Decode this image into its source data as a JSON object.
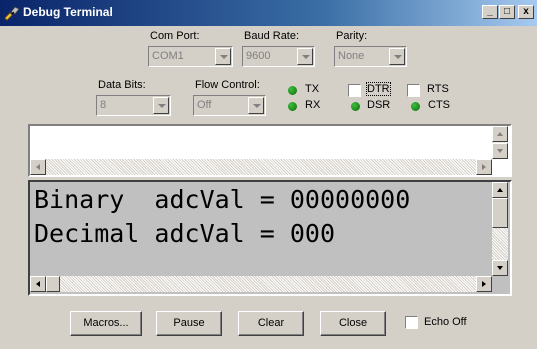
{
  "window": {
    "title": "Debug Terminal",
    "controls": {
      "minimize": "_",
      "maximize": "□",
      "close": "x"
    }
  },
  "settings": {
    "com_port": {
      "label": "Com Port:",
      "value": "COM1"
    },
    "baud_rate": {
      "label": "Baud Rate:",
      "value": "9600"
    },
    "parity": {
      "label": "Parity:",
      "value": "None"
    },
    "data_bits": {
      "label": "Data Bits:",
      "value": "8"
    },
    "flow_control": {
      "label": "Flow Control:",
      "value": "Off"
    }
  },
  "signals": {
    "tx": "TX",
    "rx": "RX",
    "dtr": "DTR",
    "rts": "RTS",
    "dsr": "DSR",
    "cts": "CTS",
    "led_color": "#1a8a1a"
  },
  "receive": {
    "lines": [
      "Binary  adcVal = 00000000",
      "Decimal adcVal = 000"
    ]
  },
  "buttons": {
    "macros": "Macros...",
    "pause": "Pause",
    "clear": "Clear",
    "close": "Close",
    "echo_off": "Echo Off"
  }
}
